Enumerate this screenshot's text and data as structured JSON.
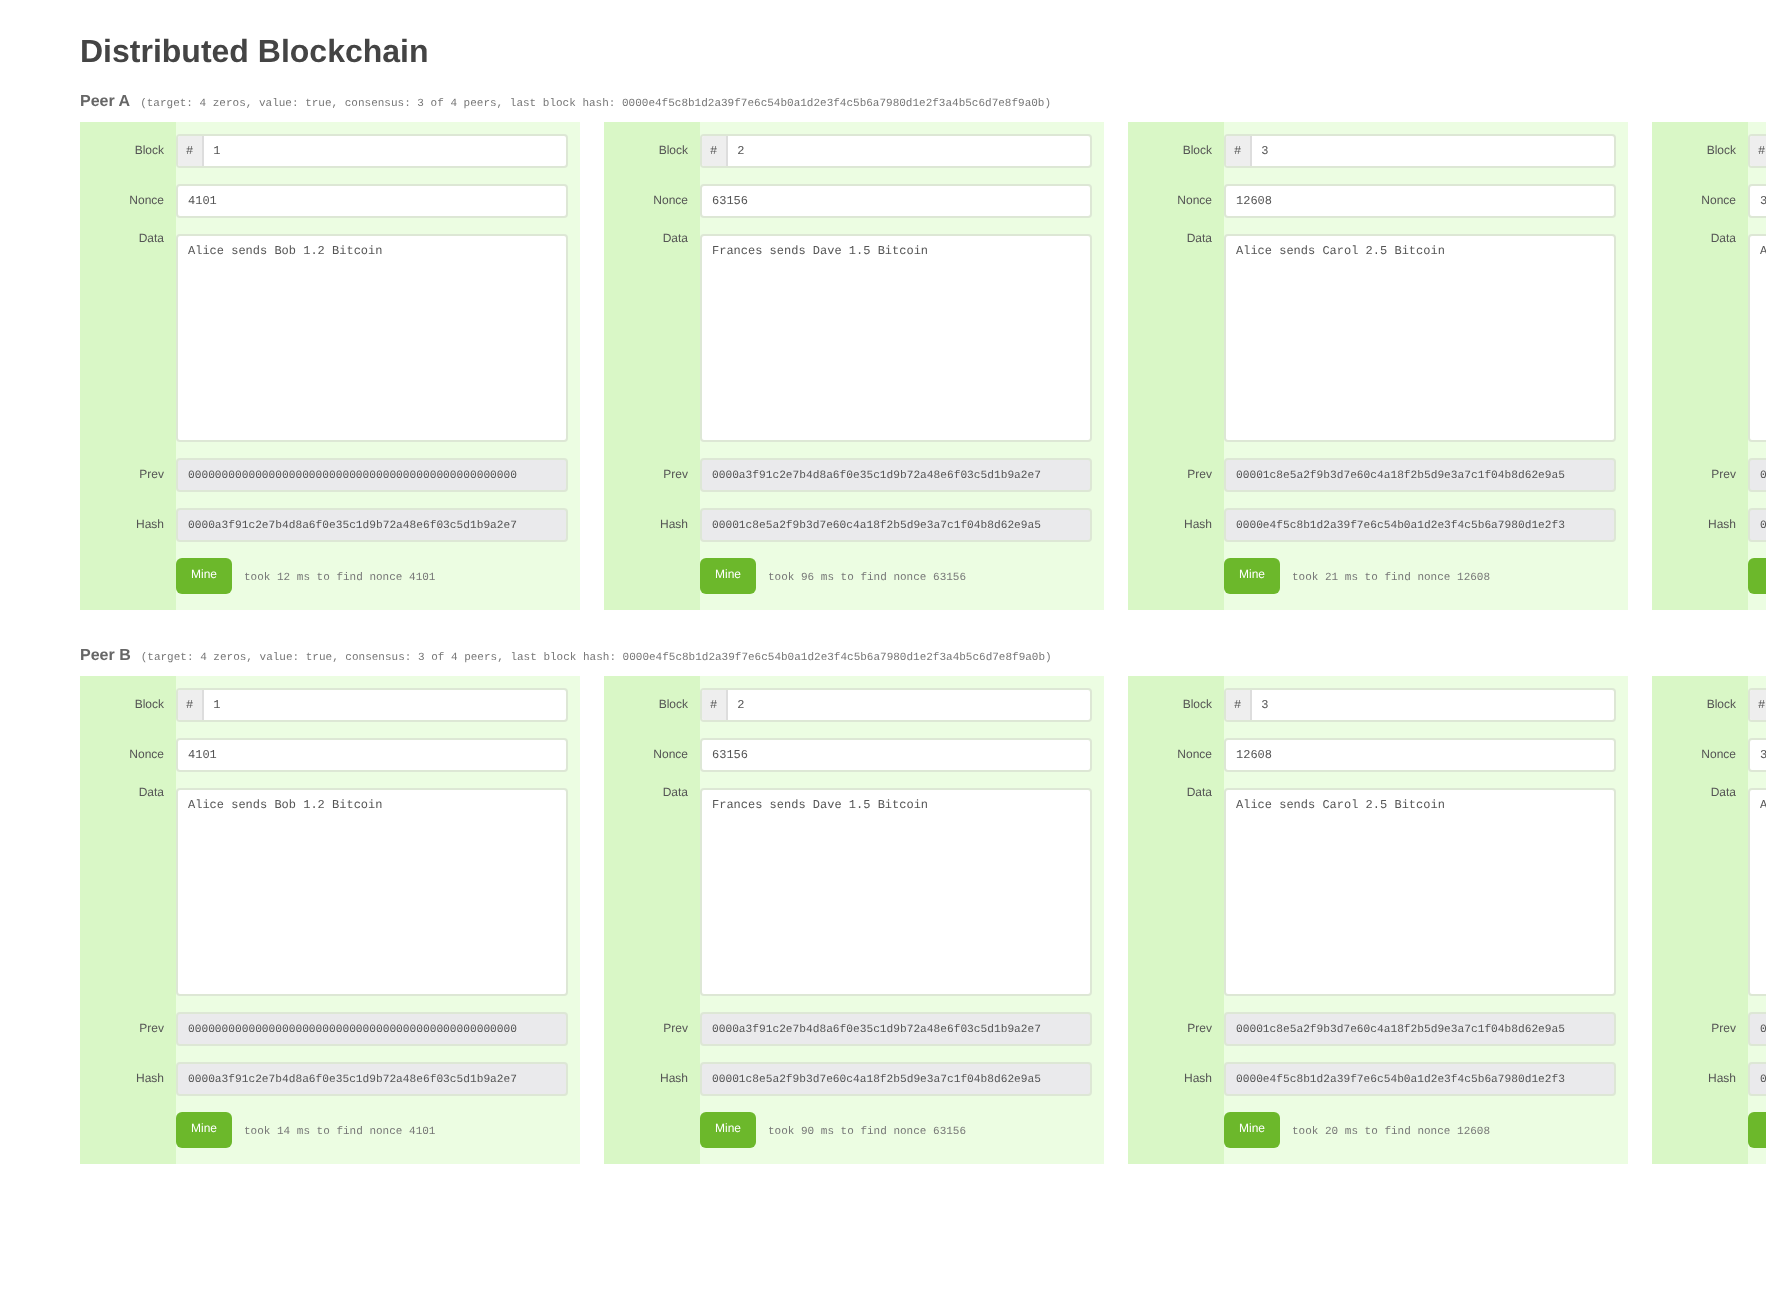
{
  "title": "Distributed Blockchain",
  "peers": [
    {
      "name": "Peer A",
      "summary": "(target: 4 zeros, value: true, consensus: 3 of 4 peers, last block hash: 0000e4f5c8b1d2a39f7e6c54b0a1d2e3f4c5b6a7980d1e2f3a4b5c6d7e8f9a0b)",
      "blocks": [
        {
          "rows": [
            {
              "kind": "block",
              "label": "Block",
              "prefix": "#",
              "value": "1"
            },
            {
              "kind": "text",
              "label": "Nonce",
              "value": "4101"
            },
            {
              "kind": "area",
              "label": "Data",
              "value": "Alice sends Bob 1.2 Bitcoin"
            },
            {
              "kind": "hash",
              "label": "Prev",
              "value": "0000000000000000000000000000000000000000000000000"
            },
            {
              "kind": "hash",
              "label": "Hash",
              "value": "0000a3f91c2e7b4d8a6f0e35c1d9b72a48e6f03c5d1b9a2e7"
            }
          ],
          "mine": {
            "label": "Mine",
            "status": "took 12 ms to find nonce 4101"
          }
        },
        {
          "rows": [
            {
              "kind": "block",
              "label": "Block",
              "prefix": "#",
              "value": "2"
            },
            {
              "kind": "text",
              "label": "Nonce",
              "value": "63156"
            },
            {
              "kind": "area",
              "label": "Data",
              "value": "Frances sends Dave 1.5 Bitcoin"
            },
            {
              "kind": "hash",
              "label": "Prev",
              "value": "0000a3f91c2e7b4d8a6f0e35c1d9b72a48e6f03c5d1b9a2e7"
            },
            {
              "kind": "hash",
              "label": "Hash",
              "value": "00001c8e5a2f9b3d7e60c4a18f2b5d9e3a7c1f04b8d62e9a5"
            }
          ],
          "mine": {
            "label": "Mine",
            "status": "took 96 ms to find nonce 63156"
          }
        },
        {
          "rows": [
            {
              "kind": "block",
              "label": "Block",
              "prefix": "#",
              "value": "3"
            },
            {
              "kind": "text",
              "label": "Nonce",
              "value": "12608"
            },
            {
              "kind": "area",
              "label": "Data",
              "value": "Alice sends Carol 2.5 Bitcoin"
            },
            {
              "kind": "hash",
              "label": "Prev",
              "value": "00001c8e5a2f9b3d7e60c4a18f2b5d9e3a7c1f04b8d62e9a5"
            },
            {
              "kind": "hash",
              "label": "Hash",
              "value": "0000e4f5c8b1d2a39f7e6c54b0a1d2e3f4c5b6a7980d1e2f3"
            }
          ],
          "mine": {
            "label": "Mine",
            "status": "took 21 ms to find nonce 12608"
          }
        },
        {
          "rows": [
            {
              "kind": "block",
              "label": "Block",
              "prefix": "#"
            },
            {
              "kind": "text",
              "label": "Nonce",
              "value": "3"
            },
            {
              "kind": "area",
              "label": "Data",
              "value": "A"
            },
            {
              "kind": "hash",
              "label": "Prev",
              "value": "0"
            },
            {
              "kind": "hash",
              "label": "Hash",
              "value": "0"
            }
          ]
        }
      ]
    },
    {
      "name": "Peer B",
      "summary": "(target: 4 zeros, value: true, consensus: 3 of 4 peers, last block hash: 0000e4f5c8b1d2a39f7e6c54b0a1d2e3f4c5b6a7980d1e2f3a4b5c6d7e8f9a0b)",
      "blocks": [
        {
          "rows": [
            {
              "kind": "block",
              "label": "Block",
              "prefix": "#",
              "value": "1"
            },
            {
              "kind": "text",
              "label": "Nonce",
              "value": "4101"
            },
            {
              "kind": "area",
              "label": "Data",
              "value": "Alice sends Bob 1.2 Bitcoin"
            },
            {
              "kind": "hash",
              "label": "Prev",
              "value": "0000000000000000000000000000000000000000000000000"
            },
            {
              "kind": "hash",
              "label": "Hash",
              "value": "0000a3f91c2e7b4d8a6f0e35c1d9b72a48e6f03c5d1b9a2e7"
            }
          ],
          "mine": {
            "label": "Mine",
            "status": "took 14 ms to find nonce 4101"
          }
        },
        {
          "rows": [
            {
              "kind": "block",
              "label": "Block",
              "prefix": "#",
              "value": "2"
            },
            {
              "kind": "text",
              "label": "Nonce",
              "value": "63156"
            },
            {
              "kind": "area",
              "label": "Data",
              "value": "Frances sends Dave 1.5 Bitcoin"
            },
            {
              "kind": "hash",
              "label": "Prev",
              "value": "0000a3f91c2e7b4d8a6f0e35c1d9b72a48e6f03c5d1b9a2e7"
            },
            {
              "kind": "hash",
              "label": "Hash",
              "value": "00001c8e5a2f9b3d7e60c4a18f2b5d9e3a7c1f04b8d62e9a5"
            }
          ],
          "mine": {
            "label": "Mine",
            "status": "took 90 ms to find nonce 63156"
          }
        },
        {
          "rows": [
            {
              "kind": "block",
              "label": "Block",
              "prefix": "#",
              "value": "3"
            },
            {
              "kind": "text",
              "label": "Nonce",
              "value": "12608"
            },
            {
              "kind": "area",
              "label": "Data",
              "value": "Alice sends Carol 2.5 Bitcoin"
            },
            {
              "kind": "hash",
              "label": "Prev",
              "value": "00001c8e5a2f9b3d7e60c4a18f2b5d9e3a7c1f04b8d62e9a5"
            },
            {
              "kind": "hash",
              "label": "Hash",
              "value": "0000e4f5c8b1d2a39f7e6c54b0a1d2e3f4c5b6a7980d1e2f3"
            }
          ],
          "mine": {
            "label": "Mine",
            "status": "took 20 ms to find nonce 12608"
          }
        },
        {
          "rows": [
            {
              "kind": "block",
              "label": "Block",
              "prefix": "#"
            },
            {
              "kind": "text",
              "label": "Nonce",
              "value": "3"
            },
            {
              "kind": "area",
              "label": "Data",
              "value": "A"
            },
            {
              "kind": "hash",
              "label": "Prev",
              "value": "0"
            },
            {
              "kind": "hash",
              "label": "Hash",
              "value": "0"
            }
          ]
        }
      ]
    }
  ]
}
